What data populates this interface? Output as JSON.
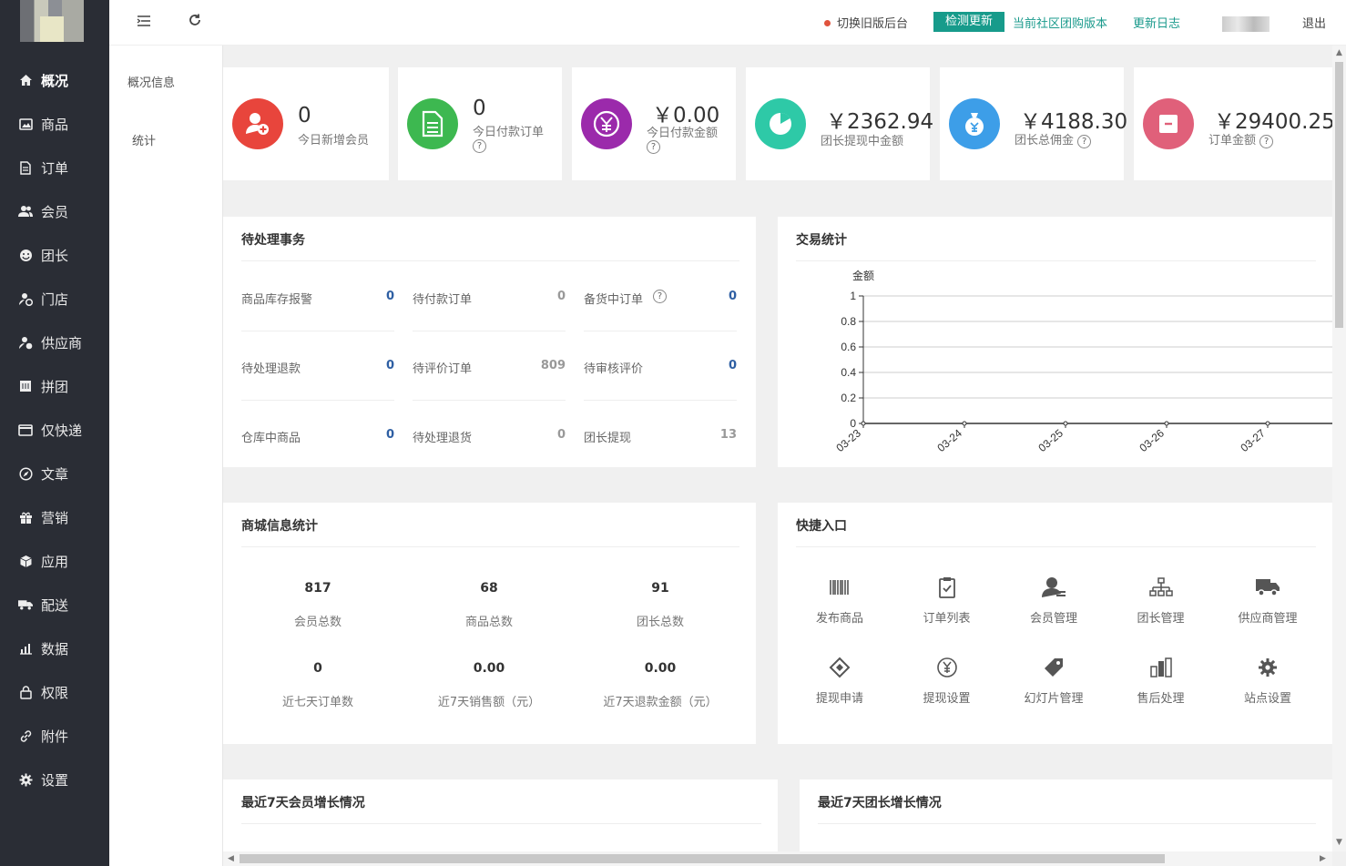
{
  "sidebar": {
    "items": [
      {
        "label": "概况",
        "icon": "home-icon"
      },
      {
        "label": "商品",
        "icon": "image-icon"
      },
      {
        "label": "订单",
        "icon": "document-icon"
      },
      {
        "label": "会员",
        "icon": "users-icon"
      },
      {
        "label": "团长",
        "icon": "smile-icon"
      },
      {
        "label": "门店",
        "icon": "store-user-icon"
      },
      {
        "label": "供应商",
        "icon": "supplier-icon"
      },
      {
        "label": "拼团",
        "icon": "group-icon"
      },
      {
        "label": "仅快递",
        "icon": "card-icon"
      },
      {
        "label": "文章",
        "icon": "compass-icon"
      },
      {
        "label": "营销",
        "icon": "gift-icon"
      },
      {
        "label": "应用",
        "icon": "cube-icon"
      },
      {
        "label": "配送",
        "icon": "truck-icon"
      },
      {
        "label": "数据",
        "icon": "chart-icon"
      },
      {
        "label": "权限",
        "icon": "lock-icon"
      },
      {
        "label": "附件",
        "icon": "link-icon"
      },
      {
        "label": "设置",
        "icon": "gear-icon"
      }
    ]
  },
  "subnav": {
    "items": [
      "概况信息",
      "统计"
    ]
  },
  "topbar": {
    "switch_label": "切换旧版后台",
    "check_update": "检测更新",
    "version_link": "当前社区团购版本",
    "changelog": "更新日志",
    "logout": "退出"
  },
  "stats": [
    {
      "value": "0",
      "label": "今日新增会员",
      "color": "#e8453c",
      "icon": "add-user-icon"
    },
    {
      "value": "0",
      "label": "今日付款订单",
      "color": "#3db850",
      "icon": "document-icon"
    },
    {
      "value": "￥0.00",
      "label": "今日付款金额",
      "color": "#9b2aab",
      "icon": "yen-icon"
    },
    {
      "value": "￥2362.94",
      "label": "团长提现中金额",
      "color": "#2ec9a7",
      "icon": "pie-icon"
    },
    {
      "value": "￥4188.30",
      "label": "团长总佣金",
      "color": "#3d9ee8",
      "icon": "moneybag-icon"
    },
    {
      "value": "￥29400.25",
      "label": "订单金额",
      "color": "#e0607a",
      "icon": "box-icon"
    }
  ],
  "todo": {
    "title": "待处理事务",
    "items": [
      {
        "label": "商品库存报警",
        "value": "0"
      },
      {
        "label": "待付款订单",
        "value": "0"
      },
      {
        "label": "备货中订单",
        "value": "0"
      },
      {
        "label": "待处理退款",
        "value": "0"
      },
      {
        "label": "待评价订单",
        "value": "809"
      },
      {
        "label": "待审核评价",
        "value": "0"
      },
      {
        "label": "仓库中商品",
        "value": "0"
      },
      {
        "label": "待处理退货",
        "value": "0"
      },
      {
        "label": "团长提现",
        "value": "13"
      }
    ]
  },
  "trade": {
    "title": "交易统计"
  },
  "chart_data": {
    "type": "line",
    "ylabel": "金额",
    "categories": [
      "03-23",
      "03-24",
      "03-25",
      "03-26",
      "03-27"
    ],
    "series": [
      {
        "values": [
          0,
          0,
          0,
          0,
          0
        ]
      }
    ],
    "ylim": [
      0,
      1
    ],
    "yticks": [
      "0",
      "0.2",
      "0.4",
      "0.6",
      "0.8",
      "1"
    ],
    "grid": true
  },
  "mallinfo": {
    "title": "商城信息统计",
    "items": [
      {
        "value": "817",
        "label": "会员总数"
      },
      {
        "value": "68",
        "label": "商品总数"
      },
      {
        "value": "91",
        "label": "团长总数"
      },
      {
        "value": "0",
        "label": "近七天订单数"
      },
      {
        "value": "0.00",
        "label": "近7天销售额（元）"
      },
      {
        "value": "0.00",
        "label": "近7天退款金额（元）"
      }
    ]
  },
  "quick": {
    "title": "快捷入口",
    "items": [
      {
        "label": "发布商品",
        "icon": "barcode-icon"
      },
      {
        "label": "订单列表",
        "icon": "clipboard-check-icon"
      },
      {
        "label": "会员管理",
        "icon": "user-manage-icon"
      },
      {
        "label": "团长管理",
        "icon": "sitemap-icon"
      },
      {
        "label": "供应商管理",
        "icon": "truck-icon"
      },
      {
        "label": "提现申请",
        "icon": "ticket-icon"
      },
      {
        "label": "提现设置",
        "icon": "yen-circle-icon"
      },
      {
        "label": "幻灯片管理",
        "icon": "tag-icon"
      },
      {
        "label": "售后处理",
        "icon": "bar-blocks-icon"
      },
      {
        "label": "站点设置",
        "icon": "gear-icon"
      }
    ]
  },
  "growth": {
    "member_title": "最近7天会员增长情况",
    "leader_title": "最近7天团长增长情况"
  }
}
